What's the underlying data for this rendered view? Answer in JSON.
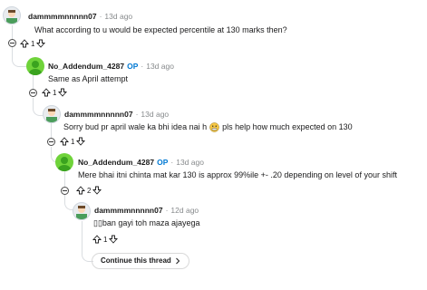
{
  "comments": [
    {
      "user": "dammmmnnnnn07",
      "op": "",
      "time": "13d ago",
      "body": "What according to u would be expected percentile at 130 marks then?",
      "score": "1"
    },
    {
      "user": "No_Addendum_4287",
      "op": "OP",
      "time": "13d ago",
      "body": "Same as April attempt",
      "score": "1"
    },
    {
      "user": "dammmmnnnnn07",
      "op": "",
      "time": "13d ago",
      "body_before": "Sorry bud pr april wale ka bhi idea nai h",
      "body_after": "pls help how much expected on 130",
      "score": "1"
    },
    {
      "user": "No_Addendum_4287",
      "op": "OP",
      "time": "13d ago",
      "body": "Mere bhai itni chinta mat kar 130 is approx 99%ile +- .20 depending on level of your shift",
      "score": "2"
    },
    {
      "user": "dammmmnnnnn07",
      "op": "",
      "time": "12d ago",
      "body": "▯▯ban gayi toh maza ajayega",
      "score": "1"
    }
  ],
  "separator": "·",
  "continue_label": "Continue this thread",
  "colors": {
    "op": "#0079d3",
    "meta": "#878a8c",
    "line": "#dadde1",
    "green_avatar": "#6fd33a"
  }
}
